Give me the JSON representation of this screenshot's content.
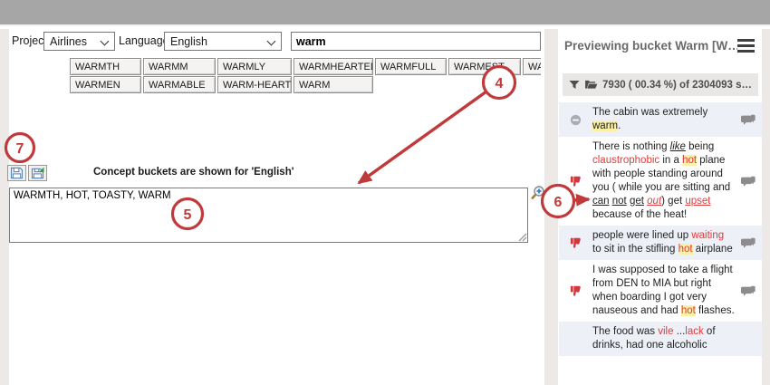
{
  "toolbar": {
    "project_label": "Project:",
    "project_value": "Airlines",
    "language_label": "Language:",
    "language_value": "English",
    "search_value": "warm"
  },
  "chips": {
    "row1": [
      "WARMTH",
      "WARMM",
      "WARMLY",
      "WARMHEARTED",
      "WARMFULL",
      "WARMEST",
      "WARM"
    ],
    "row2": [
      "WARMEN",
      "WARMABLE",
      "WARM-HEARTED",
      "WARM"
    ]
  },
  "bucket_editor": {
    "heading": "Concept buckets are shown for 'English'",
    "terms_value": "WARMTH, HOT, TOASTY, WARM",
    "icons": {
      "save": "floppy-save-icon",
      "save_import": "floppy-import-icon",
      "zoom": "magnifier-plus-icon"
    }
  },
  "preview_panel": {
    "title": "Previewing bucket Warm [W…",
    "menu_icon": "hamburger-menu-icon",
    "filter": {
      "funnel_icon": "filter-funnel-icon",
      "folder_icon": "folder-open-icon",
      "summary": "7930 ( 00.34 %) of 2304093 s…"
    },
    "items": [
      {
        "alt": true,
        "sentiment": "neutral",
        "comment": true,
        "segments": [
          {
            "t": "The cabin was extremely "
          },
          {
            "t": "warm",
            "hl": true
          },
          {
            "t": "."
          }
        ]
      },
      {
        "alt": false,
        "sentiment": "negative",
        "comment": true,
        "segments": [
          {
            "t": "There is nothing "
          },
          {
            "t": "like",
            "i": true,
            "u": true
          },
          {
            "t": " being "
          },
          {
            "t": "claustrophobic",
            "red": true
          },
          {
            "t": " in a "
          },
          {
            "t": "hot",
            "red": true,
            "hl": true
          },
          {
            "t": " plane with people standing around you ( while you are sitting and "
          },
          {
            "t": "can",
            "u": true
          },
          {
            "t": " "
          },
          {
            "t": "not",
            "u": true
          },
          {
            "t": " "
          },
          {
            "t": "get",
            "u": true
          },
          {
            "t": " "
          },
          {
            "t": "out",
            "red": true,
            "i": true,
            "u": true
          },
          {
            "t": ") get "
          },
          {
            "t": "upset",
            "red": true,
            "u": true
          },
          {
            "t": " because of the heat!"
          }
        ]
      },
      {
        "alt": true,
        "sentiment": "negative",
        "comment": true,
        "segments": [
          {
            "t": "people were lined up "
          },
          {
            "t": "waiting",
            "red": true
          },
          {
            "t": " to sit in the stifling "
          },
          {
            "t": "hot",
            "red": true,
            "hl": true
          },
          {
            "t": " airplane"
          }
        ]
      },
      {
        "alt": false,
        "sentiment": "negative",
        "comment": true,
        "segments": [
          {
            "t": "I was supposed to take a flight from DEN to MIA but right when boarding I got very nauseous and had "
          },
          {
            "t": "hot",
            "red": true,
            "hl": true
          },
          {
            "t": " flashes."
          }
        ]
      },
      {
        "alt": true,
        "sentiment": null,
        "comment": false,
        "segments": [
          {
            "t": "The food was "
          },
          {
            "t": "vile",
            "red": true
          },
          {
            "t": " ..."
          },
          {
            "t": "lack",
            "red": true
          },
          {
            "t": " of drinks, had one alcoholic"
          }
        ]
      }
    ]
  },
  "annotations": {
    "callouts": [
      {
        "label": "4"
      },
      {
        "label": "5"
      },
      {
        "label": "6"
      },
      {
        "label": "7"
      }
    ]
  },
  "colors": {
    "topbar": "#a6a6a6",
    "annotation_red": "#c0393b",
    "highlight_yellow": "#fbf0a8",
    "negative_text": "#e23b3b",
    "alt_row": "#edf0f6",
    "thumb_red": "#d2373d",
    "panel_title": "#6a6a6a"
  }
}
